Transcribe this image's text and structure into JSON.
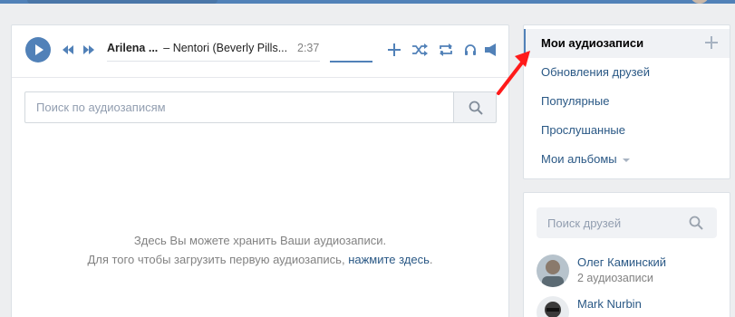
{
  "player": {
    "artist": "Arilena ...",
    "title": "– Nentori (Beverly Pills...",
    "duration": "2:37",
    "icons": [
      "play-icon",
      "prev-icon",
      "next-icon",
      "add-icon",
      "shuffle-icon",
      "repeat-icon",
      "headphones-icon",
      "broadcast-icon"
    ]
  },
  "search": {
    "placeholder": "Поиск по аудиозаписям"
  },
  "empty_state": {
    "line1": "Здесь Вы можете хранить Ваши аудиозаписи.",
    "line2_prefix": "Для того чтобы загрузить первую аудиозапись, ",
    "link": "нажмите здесь",
    "line2_suffix": "."
  },
  "nav": {
    "items": [
      {
        "label": "Мои аудиозаписи",
        "active": true
      },
      {
        "label": "Обновления друзей"
      },
      {
        "label": "Популярные"
      },
      {
        "label": "Прослушанные"
      },
      {
        "label": "Мои альбомы"
      }
    ]
  },
  "friends": {
    "placeholder": "Поиск друзей",
    "list": [
      {
        "name": "Олег Каминский",
        "sub": "2 аудиозаписи"
      },
      {
        "name": "Mark Nurbin",
        "sub": ""
      }
    ]
  },
  "colors": {
    "accent": "#5181b8",
    "link": "#2a5885",
    "annotation_arrow": "#ff1a1a"
  }
}
